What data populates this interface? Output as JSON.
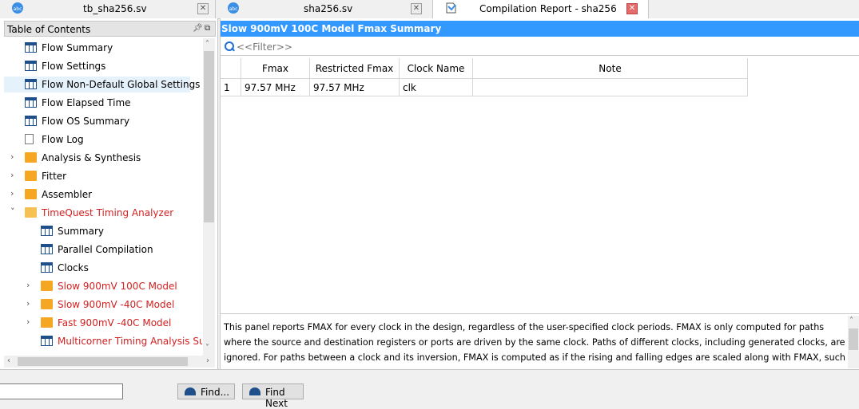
{
  "tabs": [
    {
      "label": "tb_sha256.sv",
      "icon": "abc-source-icon",
      "close": "✕"
    },
    {
      "label": "sha256.sv",
      "icon": "abc-source-icon",
      "close": "✕"
    },
    {
      "label": "Compilation Report - sha256",
      "icon": "report-icon",
      "close": "✕",
      "active": true
    }
  ],
  "toc": {
    "title": "Table of Contents",
    "items": [
      {
        "label": "Flow Summary",
        "icon": "table-icon"
      },
      {
        "label": "Flow Settings",
        "icon": "table-icon"
      },
      {
        "label": "Flow Non-Default Global Settings",
        "icon": "table-icon",
        "selected": true
      },
      {
        "label": "Flow Elapsed Time",
        "icon": "table-icon"
      },
      {
        "label": "Flow OS Summary",
        "icon": "table-icon"
      },
      {
        "label": "Flow Log",
        "icon": "log-icon"
      },
      {
        "label": "Analysis & Synthesis",
        "icon": "folder-icon",
        "expander": "collapsed"
      },
      {
        "label": "Fitter",
        "icon": "folder-icon",
        "expander": "collapsed"
      },
      {
        "label": "Assembler",
        "icon": "folder-icon",
        "expander": "collapsed"
      },
      {
        "label": "TimeQuest Timing Analyzer",
        "icon": "folder-open-icon",
        "expander": "expanded",
        "color": "#d21f1f"
      },
      {
        "label": "Summary",
        "icon": "table-icon",
        "level": 1
      },
      {
        "label": "Parallel Compilation",
        "icon": "table-icon",
        "level": 1
      },
      {
        "label": "Clocks",
        "icon": "table-icon",
        "level": 1
      },
      {
        "label": "Slow 900mV 100C Model",
        "icon": "folder-icon",
        "level": 1,
        "expander": "collapsed",
        "color": "#d21f1f"
      },
      {
        "label": "Slow 900mV -40C Model",
        "icon": "folder-icon",
        "level": 1,
        "expander": "collapsed",
        "color": "#d21f1f"
      },
      {
        "label": "Fast 900mV -40C Model",
        "icon": "folder-icon",
        "level": 1,
        "expander": "collapsed",
        "color": "#d21f1f"
      },
      {
        "label": "Multicorner Timing Analysis Summary",
        "icon": "table-icon",
        "level": 1,
        "color": "#d21f1f"
      }
    ]
  },
  "panel": {
    "title": "Slow 900mV 100C Model Fmax Summary",
    "filter_placeholder": "<<Filter>>",
    "columns": [
      "",
      "Fmax",
      "Restricted Fmax",
      "Clock Name",
      "Note"
    ],
    "rows": [
      [
        "1",
        "97.57 MHz",
        "97.57 MHz",
        "clk",
        ""
      ]
    ],
    "description": "This panel reports FMAX for every clock in the design, regardless of the user-specified clock periods.  FMAX is only computed for paths where the source and destination registers or ports are driven by the same clock.  Paths of different clocks, including generated clocks, are ignored.  For paths between a clock and its inversion, FMAX is computed as if the rising and falling edges are scaled along with FMAX, such that the duty cycle (in terms of a percentage) is maintained. Altera recommends that you always use clock constraints and other slack reports for sign-off analysis."
  },
  "bottombar": {
    "find_value": "",
    "find_label": "Find...",
    "find_next_label": "Find Next"
  },
  "colors": {
    "accent": "#3399ff",
    "error_text": "#d21f1f",
    "folder": "#f5a623"
  }
}
